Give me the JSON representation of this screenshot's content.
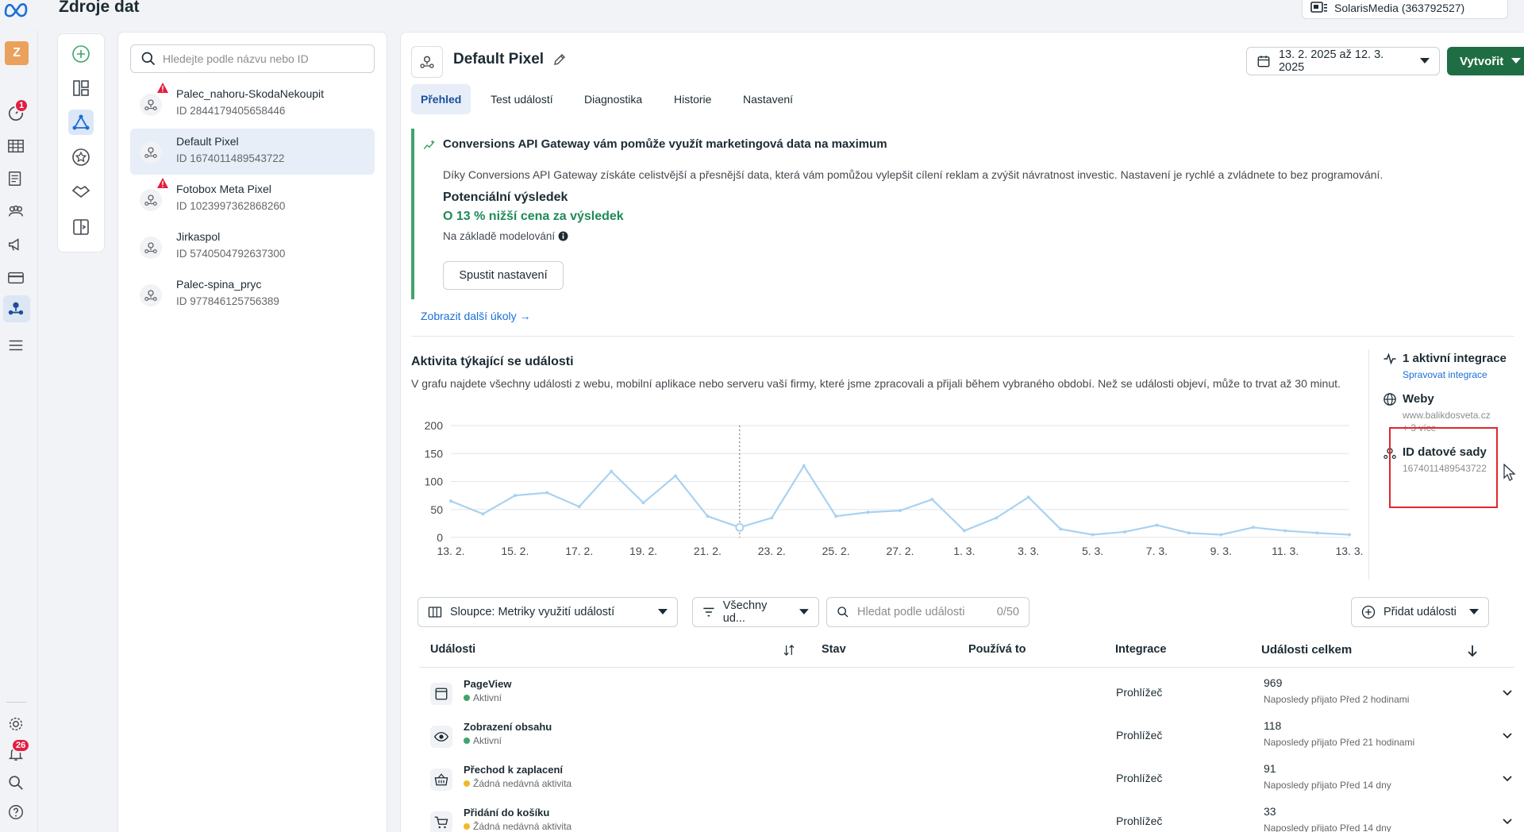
{
  "header": {
    "app_title": "Zdroje dat",
    "account_label": "SolarisMedia (363792527)"
  },
  "rail": {
    "avatar_letter": "Z",
    "notifications_badge": "1",
    "alerts_badge": "26"
  },
  "sources": {
    "search_placeholder": "Hledejte podle názvu nebo ID",
    "items": [
      {
        "name": "Palec_nahoru-SkodaNekoupit",
        "id": "ID 2844179405658446",
        "warning": true,
        "selected": false
      },
      {
        "name": "Default Pixel",
        "id": "ID 1674011489543722",
        "warning": false,
        "selected": true
      },
      {
        "name": "Fotobox Meta Pixel",
        "id": "ID 1023997362868260",
        "warning": true,
        "selected": false
      },
      {
        "name": "Jirkaspol",
        "id": "ID 5740504792637300",
        "warning": false,
        "selected": false
      },
      {
        "name": "Palec-spina_pryc",
        "id": "ID 977846125756389",
        "warning": false,
        "selected": false
      }
    ]
  },
  "main": {
    "title": "Default Pixel",
    "date_range": "13. 2. 2025 až 12. 3. 2025",
    "create_label": "Vytvořit",
    "tabs": [
      "Přehled",
      "Test událostí",
      "Diagnostika",
      "Historie",
      "Nastavení"
    ],
    "active_tab": "Přehled"
  },
  "banner": {
    "title": "Conversions API Gateway vám pomůže využít marketingová data na maximum",
    "description": "Díky Conversions API Gateway získáte celistvější a přesnější data, která vám pomůžou vylepšit cílení reklam a zvýšit návratnost investic. Nastavení je rychlé a zvládnete to bez programování.",
    "result_heading": "Potenciální výsledek",
    "result_value": "O 13 % nižší cena za výsledek",
    "model_note": "Na základě modelování",
    "button_label": "Spustit nastavení",
    "more_link": "Zobrazit další úkoly →"
  },
  "activity": {
    "title": "Aktivita týkající se události",
    "description": "V grafu najdete všechny události z webu, mobilní aplikace nebo serveru vaší firmy, které jsme zpracovali a přijali během vybraného období. Než se události objeví, může to trvat až 30 minut."
  },
  "chart_data": {
    "type": "line",
    "title": "",
    "xlabel": "",
    "ylabel": "",
    "ylim": [
      0,
      200
    ],
    "yticks": [
      0,
      50,
      100,
      150,
      200
    ],
    "xtick_labels": [
      "13. 2.",
      "15. 2.",
      "17. 2.",
      "19. 2.",
      "21. 2.",
      "23. 2.",
      "25. 2.",
      "27. 2.",
      "1. 3.",
      "3. 3.",
      "5. 3.",
      "7. 3.",
      "9. 3.",
      "11. 3.",
      "13. 3."
    ],
    "x": [
      "13. 2.",
      "14. 2.",
      "15. 2.",
      "16. 2.",
      "17. 2.",
      "18. 2.",
      "19. 2.",
      "20. 2.",
      "21. 2.",
      "22. 2.",
      "23. 2.",
      "24. 2.",
      "25. 2.",
      "26. 2.",
      "27. 2.",
      "28. 2.",
      "1. 3.",
      "2. 3.",
      "3. 3.",
      "4. 3.",
      "5. 3.",
      "6. 3.",
      "7. 3.",
      "8. 3.",
      "9. 3.",
      "10. 3.",
      "11. 3.",
      "12. 3.",
      "13. 3."
    ],
    "series": [
      {
        "values": [
          65,
          42,
          75,
          80,
          55,
          118,
          62,
          110,
          38,
          18,
          35,
          128,
          38,
          45,
          48,
          68,
          12,
          35,
          72,
          15,
          5,
          10,
          22,
          8,
          5,
          18,
          12,
          8,
          5
        ]
      }
    ],
    "highlight_index": 9,
    "grid": true,
    "line_color": "#a9d2f0"
  },
  "side_info": {
    "integrations_label": "1 aktivní integrace",
    "integrations_link": "Spravovat integrace",
    "websites_label": "Weby",
    "website_value": "www.balikdosveta.cz",
    "website_more": "+ 3 více",
    "dataset_label": "ID datové sady",
    "dataset_value": "1674011489543722"
  },
  "table": {
    "columns_select": "Sloupce: Metriky využití událostí",
    "filter_label": "Všechny ud...",
    "search_placeholder": "Hledat podle události",
    "search_count": "0/50",
    "add_events_label": "Přidat události",
    "headers": {
      "events": "Události",
      "status": "Stav",
      "used_by": "Používá to",
      "integration": "Integrace",
      "total": "Události celkem"
    },
    "rows": [
      {
        "name": "PageView",
        "status": "Aktivní",
        "status_color": "#3fa56b",
        "icon": "page-icon",
        "integration": "Prohlížeč",
        "total": "969",
        "last": "Naposledy přijato Před 2 hodinami"
      },
      {
        "name": "Zobrazení obsahu",
        "status": "Aktivní",
        "status_color": "#3fa56b",
        "icon": "eye-icon",
        "integration": "Prohlížeč",
        "total": "118",
        "last": "Naposledy přijato Před 21 hodinami"
      },
      {
        "name": "Přechod k zaplacení",
        "status": "Žádná nedávná aktivita",
        "status_color": "#f0b92c",
        "icon": "basket-icon",
        "integration": "Prohlížeč",
        "total": "91",
        "last": "Naposledy přijato Před 14 dny"
      },
      {
        "name": "Přidání do košíku",
        "status": "Žádná nedávná aktivita",
        "status_color": "#f0b92c",
        "icon": "cart-icon",
        "integration": "Prohlížeč",
        "total": "33",
        "last": "Naposledy přijato Před 14 dny"
      }
    ]
  }
}
